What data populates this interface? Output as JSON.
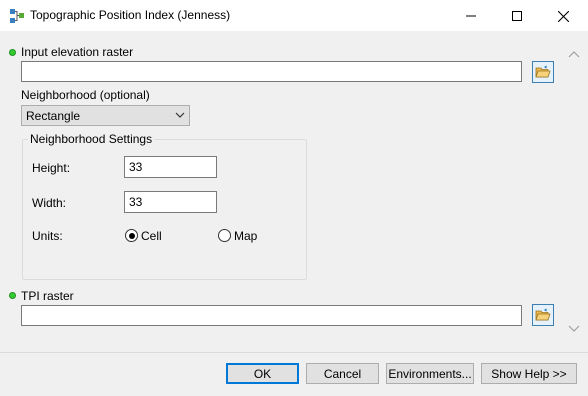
{
  "window": {
    "title": "Topographic Position Index (Jenness)",
    "app_icon": "model-tool-icon"
  },
  "inputs": {
    "elevation_label": "Input elevation raster",
    "elevation_value": "",
    "neighborhood_label": "Neighborhood (optional)",
    "neighborhood_value": "Rectangle",
    "neighborhood_settings_title": "Neighborhood Settings",
    "height_label": "Height:",
    "height_value": "33",
    "width_label": "Width:",
    "width_value": "33",
    "units_label": "Units:",
    "units_options": [
      {
        "label": "Cell",
        "selected": true
      },
      {
        "label": "Map",
        "selected": false
      }
    ],
    "tpi_label": "TPI raster",
    "tpi_value": ""
  },
  "buttons": {
    "ok": "OK",
    "cancel": "Cancel",
    "environments": "Environments...",
    "show_help": "Show Help >>"
  },
  "colors": {
    "required_dot": "#33cc33",
    "default_button_border": "#0078d7",
    "browse_button_border": "#3c7fb1"
  }
}
